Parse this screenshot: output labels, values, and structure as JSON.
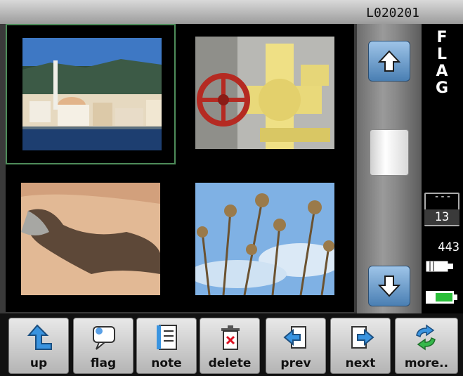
{
  "status": {
    "folder_id": "L020201"
  },
  "side_panel": {
    "mode_label_letters": [
      "F",
      "L",
      "A",
      "G"
    ],
    "folder_dashes": "---",
    "folder_count": "13",
    "image_count": "443"
  },
  "thumbnails": [
    {
      "subject": "harbor-town",
      "selected": true
    },
    {
      "subject": "yellow-pipes-red-valve",
      "selected": false
    },
    {
      "subject": "sand-shadow",
      "selected": false
    },
    {
      "subject": "dry-flower-stems-sky",
      "selected": false
    }
  ],
  "toolbar": {
    "buttons": [
      {
        "id": "up",
        "label": "up",
        "icon": "up-arrow-icon"
      },
      {
        "id": "flag",
        "label": "flag",
        "icon": "flag-bubble-icon"
      },
      {
        "id": "note",
        "label": "note",
        "icon": "note-icon"
      },
      {
        "id": "delete",
        "label": "delete",
        "icon": "trash-icon"
      },
      {
        "id": "prev",
        "label": "prev",
        "icon": "prev-icon"
      },
      {
        "id": "next",
        "label": "next",
        "icon": "next-icon"
      },
      {
        "id": "more",
        "label": "more..",
        "icon": "refresh-arrows-icon"
      }
    ]
  },
  "colors": {
    "selection": "#4e8c5a",
    "button_blue": "#4a7fb3",
    "battery": "#2bbf3a"
  }
}
